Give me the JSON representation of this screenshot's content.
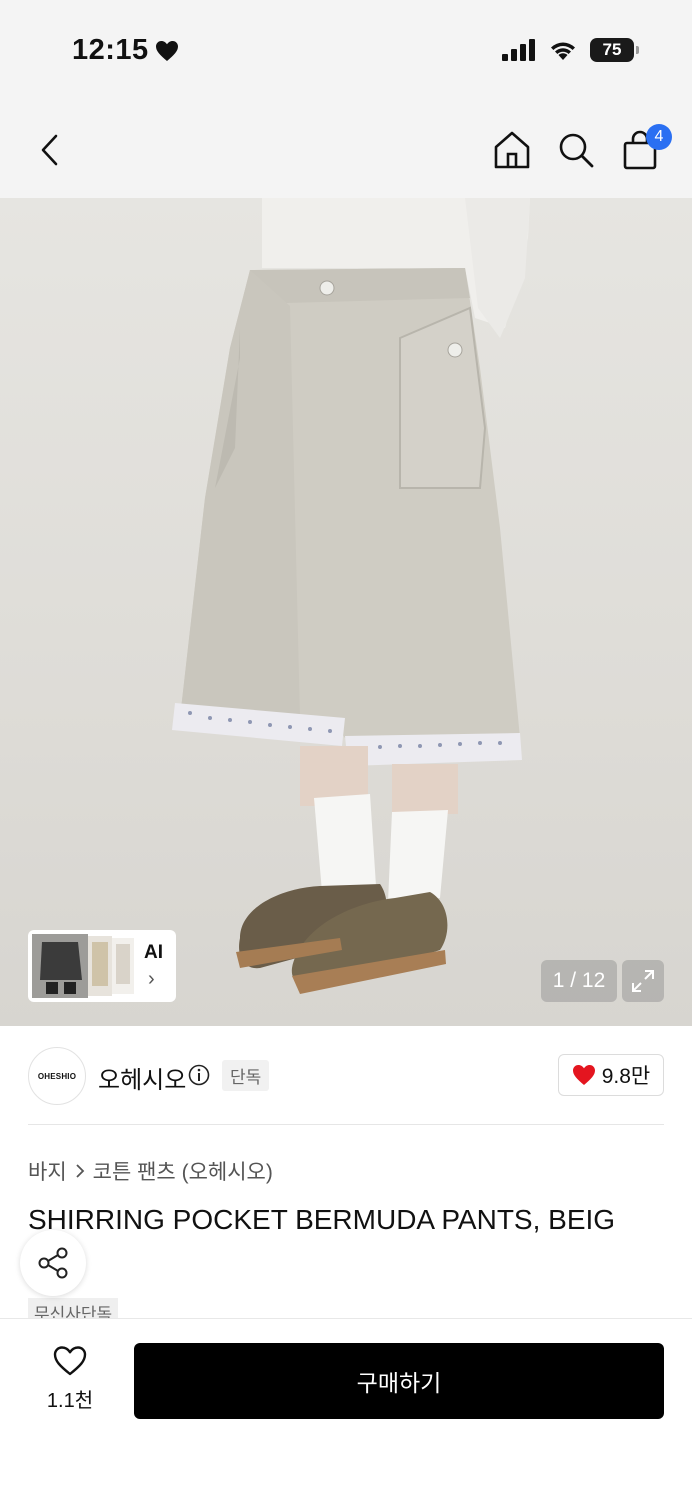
{
  "status_bar": {
    "time": "12:15",
    "battery": "75"
  },
  "nav": {
    "cart_count": "4"
  },
  "gallery": {
    "ai_label": "AI",
    "counter": "1 / 12"
  },
  "brand": {
    "logo_text": "OHESHIO",
    "name": "오헤시오",
    "exclusive_badge": "단독",
    "likes": "9.8만"
  },
  "breadcrumb": {
    "level1": "바지",
    "level2": "코튼 팬츠 (오헤시오)"
  },
  "product": {
    "title": "SHIRRING POCKET BERMUDA PANTS, BEIG",
    "tag": "무신사단독"
  },
  "bottom": {
    "wish_count": "1.1천",
    "buy_label": "구매하기"
  },
  "colors": {
    "accent": "#2a6ff2",
    "heart": "#e4151f",
    "buy_button": "#000000",
    "bar_bg": "#f4f4f4"
  }
}
